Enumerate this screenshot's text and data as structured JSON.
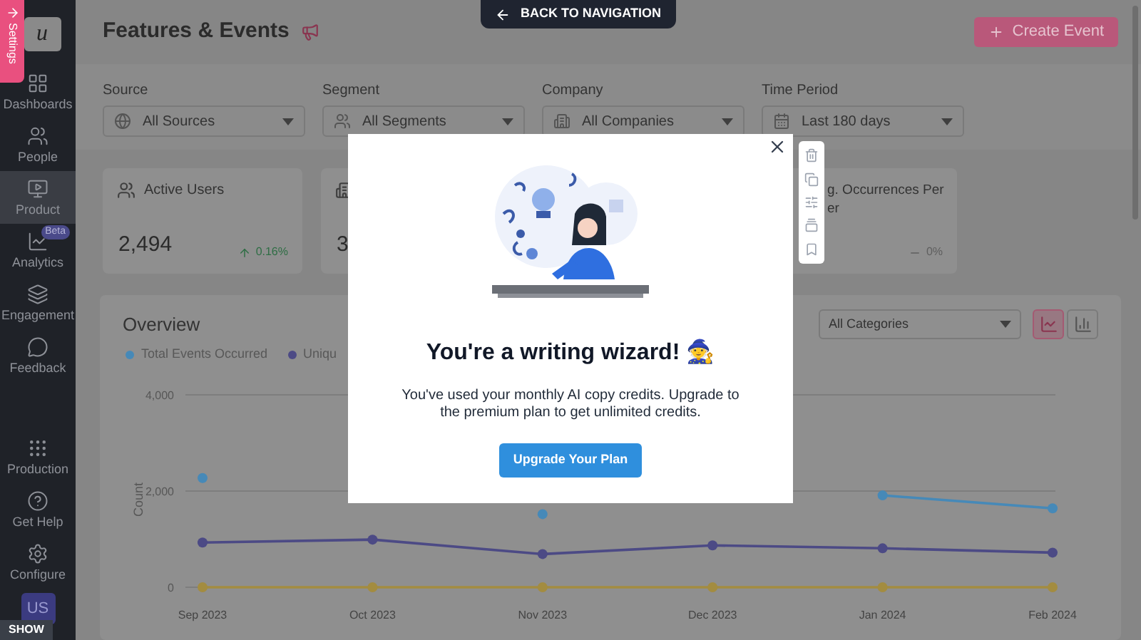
{
  "settings_tab": {
    "label": "Settings"
  },
  "logo": {
    "letter": "u"
  },
  "sidebar": {
    "items": [
      {
        "label": "Dashboards",
        "selected": false
      },
      {
        "label": "People",
        "selected": false
      },
      {
        "label": "Product",
        "selected": true
      },
      {
        "label": "Analytics",
        "selected": false,
        "badge": "Beta"
      },
      {
        "label": "Engagement",
        "selected": false
      },
      {
        "label": "Feedback",
        "selected": false
      }
    ],
    "bottom_items": [
      {
        "label": "Production",
        "selected": false
      },
      {
        "label": "Get Help",
        "selected": false
      },
      {
        "label": "Configure",
        "selected": false
      }
    ],
    "avatar": "US",
    "show_badge": "SHOW"
  },
  "back_button": "BACK TO NAVIGATION",
  "header": {
    "title": "Features & Events",
    "create_button": "Create Event"
  },
  "filters": [
    {
      "label": "Source",
      "value": "All Sources"
    },
    {
      "label": "Segment",
      "value": "All Segments"
    },
    {
      "label": "Company",
      "value": "All Companies"
    },
    {
      "label": "Time Period",
      "value": "Last 180 days"
    }
  ],
  "stats": [
    {
      "title": "Active Users",
      "value": "2,494",
      "trend": "0.16%",
      "kind": "up"
    },
    {
      "value": "3"
    },
    {
      "title": "g. Occurrences Per\ner",
      "trend": "0%",
      "kind": "flat"
    }
  ],
  "overview": {
    "title": "Overview",
    "category": "All Categories",
    "chart_types": [
      {
        "kind": "line",
        "selected": true
      },
      {
        "kind": "bar",
        "selected": false
      }
    ],
    "chart_data": {
      "type": "line",
      "ylabel": "Count",
      "categories": [
        "Sep 2023",
        "Oct 2023",
        "Nov 2023",
        "Dec 2023",
        "Jan 2024",
        "Feb 2024"
      ],
      "ylim": [
        0,
        4000
      ],
      "yticks": [
        {
          "value": 0,
          "label": "0"
        },
        {
          "value": 2000,
          "label": "2,000"
        },
        {
          "value": 4000,
          "label": "4,000"
        }
      ],
      "series": [
        {
          "name": "Total Events Occurred",
          "color": "#4689b8",
          "marker": "circle",
          "values": [
            2270,
            null,
            1520,
            null,
            1910,
            1640
          ]
        },
        {
          "name": "Uniqu",
          "color": "#4c4a85",
          "marker": "circle",
          "values": [
            930,
            990,
            690,
            870,
            810,
            720
          ]
        },
        {
          "color": "#a38c40",
          "marker": "circle",
          "values": [
            0,
            0,
            0,
            0,
            0,
            0
          ]
        }
      ]
    }
  },
  "modal": {
    "title": "You're a writing wizard! 🧙",
    "message": "You've used your monthly AI copy credits. Upgrade to the premium plan to get unlimited credits.",
    "button": "Upgrade Your Plan"
  }
}
